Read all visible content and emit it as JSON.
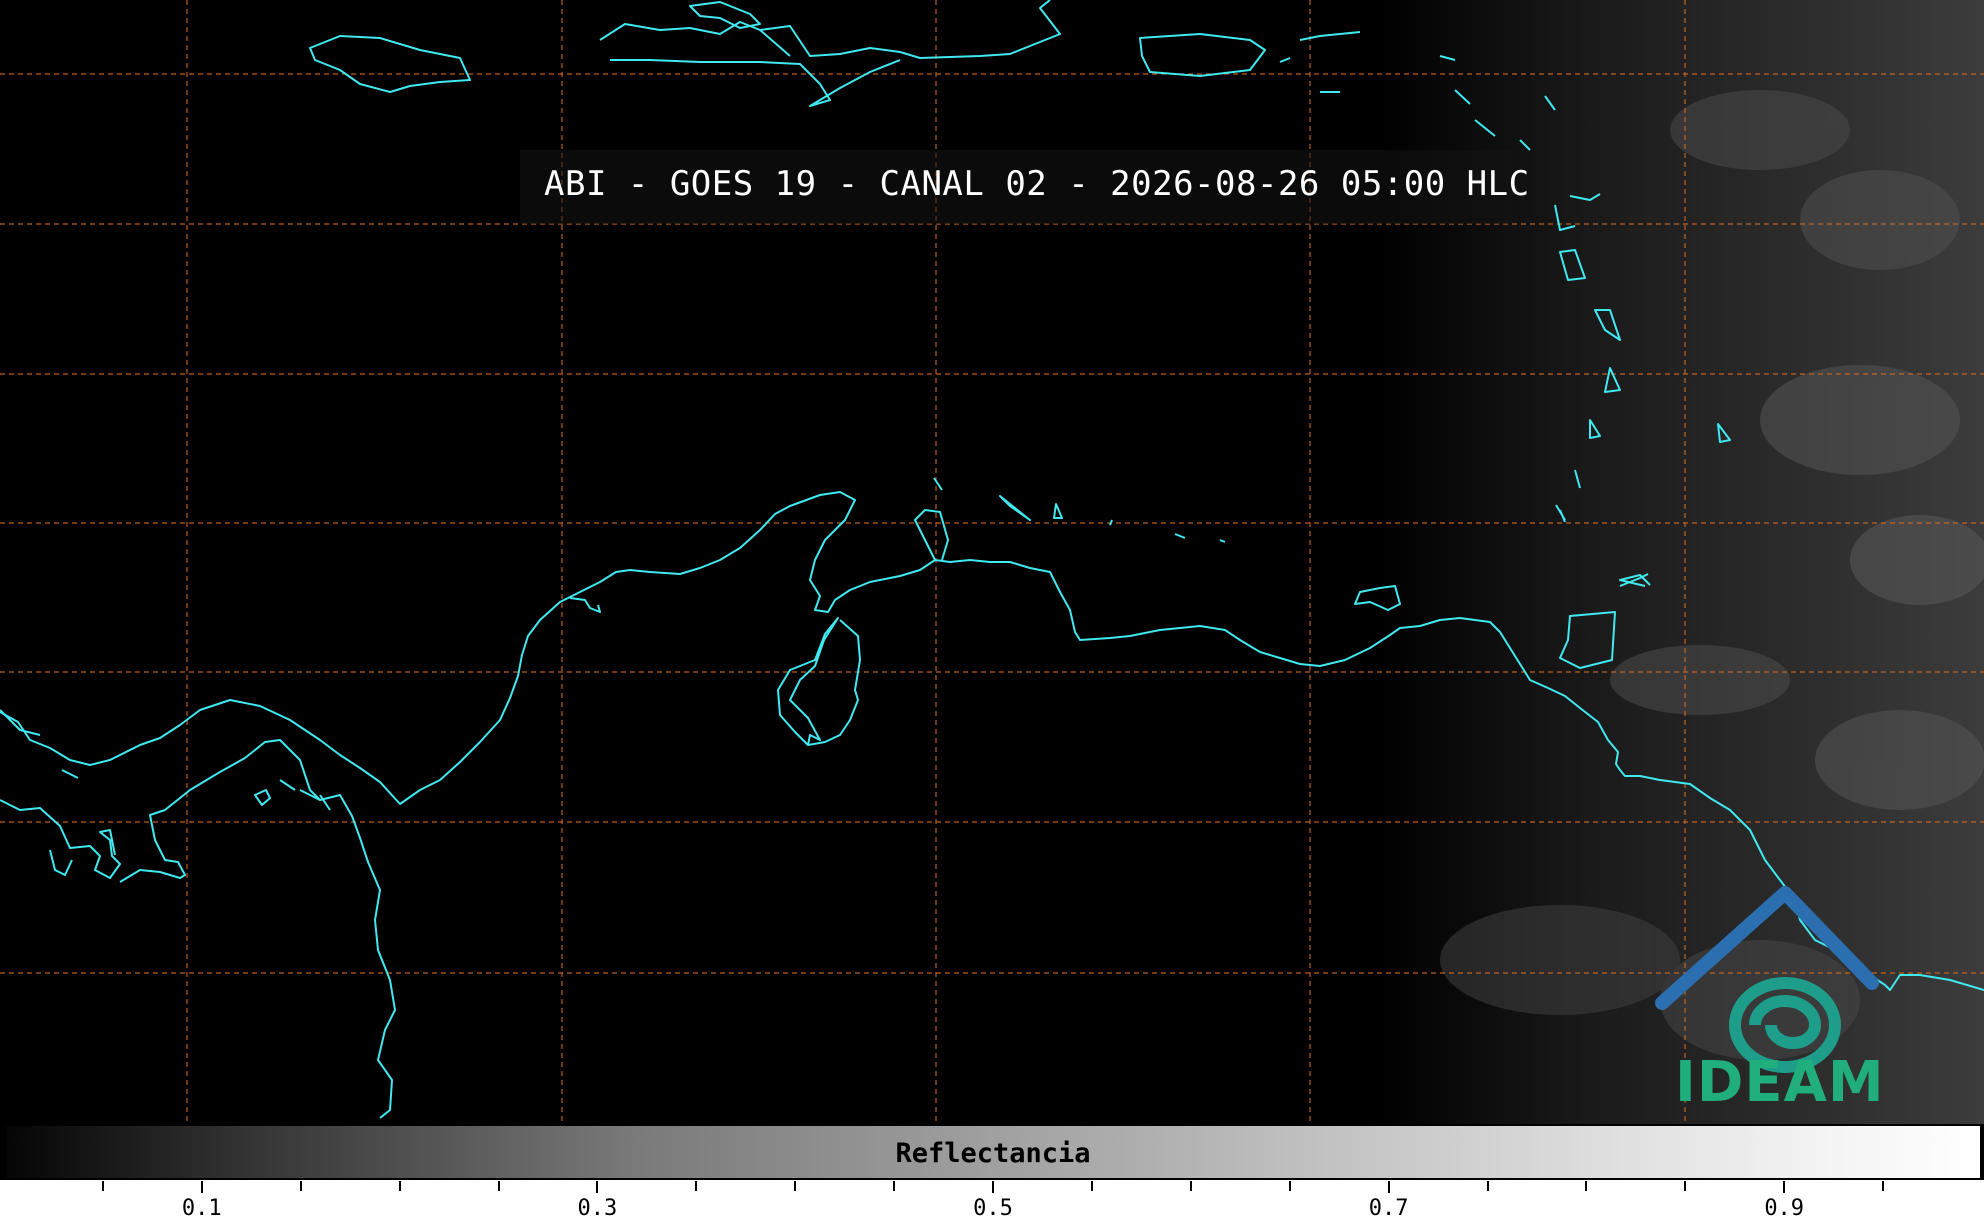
{
  "title": "ABI - GOES 19 - CANAL 02 - 2026-08-26 05:00 HLC",
  "colorbar": {
    "label": "Reflectancia",
    "ticks": [
      "0.1",
      "0.3",
      "0.5",
      "0.7",
      "0.9"
    ],
    "tick_values": [
      0.1,
      0.3,
      0.5,
      0.7,
      0.9
    ],
    "minor_values": [
      0.05,
      0.15,
      0.2,
      0.25,
      0.35,
      0.4,
      0.45,
      0.55,
      0.6,
      0.65,
      0.75,
      0.8,
      0.85,
      0.95
    ],
    "range": [
      0.0,
      1.0
    ]
  },
  "logo": {
    "text": "IDEAM",
    "colors": {
      "text": "#1fae7c",
      "roof": "#2b6fb0",
      "swirl": "#1d9d8a"
    }
  },
  "map": {
    "coastline_color": "#40e8f0",
    "gridline_color": "#d2691e",
    "background_color": "#000000",
    "cloud_region_color": "#3a3a3a"
  }
}
